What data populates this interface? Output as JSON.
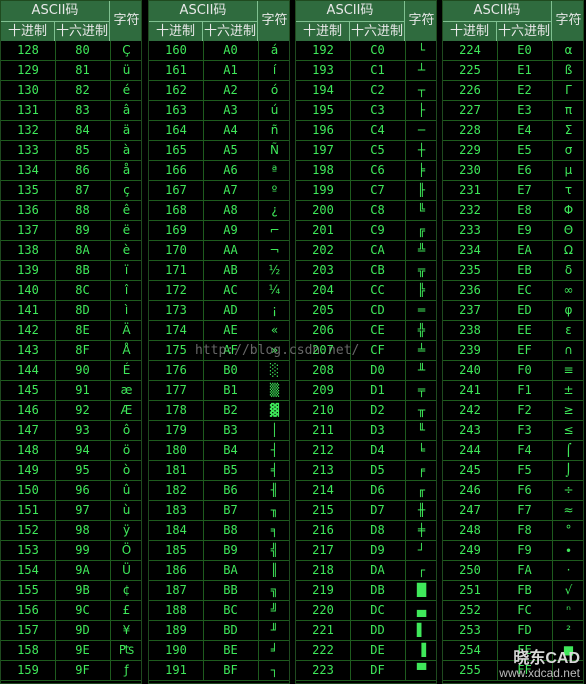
{
  "header": {
    "ascii": "ASCII码",
    "dec": "十进制",
    "hex": "十六进制",
    "char": "字符"
  },
  "watermark": "http://blog.csdn.net/",
  "logo": {
    "top": "晓东CAD",
    "bottom": "www.xdcad.net"
  },
  "colors": {
    "header_bg": "#2f6b3e",
    "text": "#3fe85a",
    "grid": "#1e5b1e"
  },
  "columns": [
    {
      "rows": [
        {
          "dec": "128",
          "hex": "80",
          "char": "Ç"
        },
        {
          "dec": "129",
          "hex": "81",
          "char": "ü"
        },
        {
          "dec": "130",
          "hex": "82",
          "char": "é"
        },
        {
          "dec": "131",
          "hex": "83",
          "char": "â"
        },
        {
          "dec": "132",
          "hex": "84",
          "char": "ä"
        },
        {
          "dec": "133",
          "hex": "85",
          "char": "à"
        },
        {
          "dec": "134",
          "hex": "86",
          "char": "å"
        },
        {
          "dec": "135",
          "hex": "87",
          "char": "ç"
        },
        {
          "dec": "136",
          "hex": "88",
          "char": "ê"
        },
        {
          "dec": "137",
          "hex": "89",
          "char": "ë"
        },
        {
          "dec": "138",
          "hex": "8A",
          "char": "è"
        },
        {
          "dec": "139",
          "hex": "8B",
          "char": "ï"
        },
        {
          "dec": "140",
          "hex": "8C",
          "char": "î"
        },
        {
          "dec": "141",
          "hex": "8D",
          "char": "ì"
        },
        {
          "dec": "142",
          "hex": "8E",
          "char": "Ä"
        },
        {
          "dec": "143",
          "hex": "8F",
          "char": "Å"
        },
        {
          "dec": "144",
          "hex": "90",
          "char": "É"
        },
        {
          "dec": "145",
          "hex": "91",
          "char": "æ"
        },
        {
          "dec": "146",
          "hex": "92",
          "char": "Æ"
        },
        {
          "dec": "147",
          "hex": "93",
          "char": "ô"
        },
        {
          "dec": "148",
          "hex": "94",
          "char": "ö"
        },
        {
          "dec": "149",
          "hex": "95",
          "char": "ò"
        },
        {
          "dec": "150",
          "hex": "96",
          "char": "û"
        },
        {
          "dec": "151",
          "hex": "97",
          "char": "ù"
        },
        {
          "dec": "152",
          "hex": "98",
          "char": "ÿ"
        },
        {
          "dec": "153",
          "hex": "99",
          "char": "Ö"
        },
        {
          "dec": "154",
          "hex": "9A",
          "char": "Ü"
        },
        {
          "dec": "155",
          "hex": "9B",
          "char": "¢"
        },
        {
          "dec": "156",
          "hex": "9C",
          "char": "£"
        },
        {
          "dec": "157",
          "hex": "9D",
          "char": "¥"
        },
        {
          "dec": "158",
          "hex": "9E",
          "char": "₧"
        },
        {
          "dec": "159",
          "hex": "9F",
          "char": "ƒ"
        }
      ]
    },
    {
      "rows": [
        {
          "dec": "160",
          "hex": "A0",
          "char": "á"
        },
        {
          "dec": "161",
          "hex": "A1",
          "char": "í"
        },
        {
          "dec": "162",
          "hex": "A2",
          "char": "ó"
        },
        {
          "dec": "163",
          "hex": "A3",
          "char": "ú"
        },
        {
          "dec": "164",
          "hex": "A4",
          "char": "ñ"
        },
        {
          "dec": "165",
          "hex": "A5",
          "char": "Ñ"
        },
        {
          "dec": "166",
          "hex": "A6",
          "char": "ª"
        },
        {
          "dec": "167",
          "hex": "A7",
          "char": "º"
        },
        {
          "dec": "168",
          "hex": "A8",
          "char": "¿"
        },
        {
          "dec": "169",
          "hex": "A9",
          "char": "⌐"
        },
        {
          "dec": "170",
          "hex": "AA",
          "char": "¬"
        },
        {
          "dec": "171",
          "hex": "AB",
          "char": "½"
        },
        {
          "dec": "172",
          "hex": "AC",
          "char": "¼"
        },
        {
          "dec": "173",
          "hex": "AD",
          "char": "¡"
        },
        {
          "dec": "174",
          "hex": "AE",
          "char": "«"
        },
        {
          "dec": "175",
          "hex": "AF",
          "char": "»"
        },
        {
          "dec": "176",
          "hex": "B0",
          "char": "░"
        },
        {
          "dec": "177",
          "hex": "B1",
          "char": "▒"
        },
        {
          "dec": "178",
          "hex": "B2",
          "char": "▓"
        },
        {
          "dec": "179",
          "hex": "B3",
          "char": "│"
        },
        {
          "dec": "180",
          "hex": "B4",
          "char": "┤"
        },
        {
          "dec": "181",
          "hex": "B5",
          "char": "╡"
        },
        {
          "dec": "182",
          "hex": "B6",
          "char": "╢"
        },
        {
          "dec": "183",
          "hex": "B7",
          "char": "╖"
        },
        {
          "dec": "184",
          "hex": "B8",
          "char": "╕"
        },
        {
          "dec": "185",
          "hex": "B9",
          "char": "╣"
        },
        {
          "dec": "186",
          "hex": "BA",
          "char": "║"
        },
        {
          "dec": "187",
          "hex": "BB",
          "char": "╗"
        },
        {
          "dec": "188",
          "hex": "BC",
          "char": "╝"
        },
        {
          "dec": "189",
          "hex": "BD",
          "char": "╜"
        },
        {
          "dec": "190",
          "hex": "BE",
          "char": "╛"
        },
        {
          "dec": "191",
          "hex": "BF",
          "char": "┐"
        }
      ]
    },
    {
      "rows": [
        {
          "dec": "192",
          "hex": "C0",
          "char": "└"
        },
        {
          "dec": "193",
          "hex": "C1",
          "char": "┴"
        },
        {
          "dec": "194",
          "hex": "C2",
          "char": "┬"
        },
        {
          "dec": "195",
          "hex": "C3",
          "char": "├"
        },
        {
          "dec": "196",
          "hex": "C4",
          "char": "─"
        },
        {
          "dec": "197",
          "hex": "C5",
          "char": "┼"
        },
        {
          "dec": "198",
          "hex": "C6",
          "char": "╞"
        },
        {
          "dec": "199",
          "hex": "C7",
          "char": "╟"
        },
        {
          "dec": "200",
          "hex": "C8",
          "char": "╚"
        },
        {
          "dec": "201",
          "hex": "C9",
          "char": "╔"
        },
        {
          "dec": "202",
          "hex": "CA",
          "char": "╩"
        },
        {
          "dec": "203",
          "hex": "CB",
          "char": "╦"
        },
        {
          "dec": "204",
          "hex": "CC",
          "char": "╠"
        },
        {
          "dec": "205",
          "hex": "CD",
          "char": "═"
        },
        {
          "dec": "206",
          "hex": "CE",
          "char": "╬"
        },
        {
          "dec": "207",
          "hex": "CF",
          "char": "╧"
        },
        {
          "dec": "208",
          "hex": "D0",
          "char": "╨"
        },
        {
          "dec": "209",
          "hex": "D1",
          "char": "╤"
        },
        {
          "dec": "210",
          "hex": "D2",
          "char": "╥"
        },
        {
          "dec": "211",
          "hex": "D3",
          "char": "╙"
        },
        {
          "dec": "212",
          "hex": "D4",
          "char": "╘"
        },
        {
          "dec": "213",
          "hex": "D5",
          "char": "╒"
        },
        {
          "dec": "214",
          "hex": "D6",
          "char": "╓"
        },
        {
          "dec": "215",
          "hex": "D7",
          "char": "╫"
        },
        {
          "dec": "216",
          "hex": "D8",
          "char": "╪"
        },
        {
          "dec": "217",
          "hex": "D9",
          "char": "┘"
        },
        {
          "dec": "218",
          "hex": "DA",
          "char": "┌"
        },
        {
          "dec": "219",
          "hex": "DB",
          "char": "█"
        },
        {
          "dec": "220",
          "hex": "DC",
          "char": "▄"
        },
        {
          "dec": "221",
          "hex": "DD",
          "char": "▌"
        },
        {
          "dec": "222",
          "hex": "DE",
          "char": "▐"
        },
        {
          "dec": "223",
          "hex": "DF",
          "char": "▀"
        }
      ]
    },
    {
      "rows": [
        {
          "dec": "224",
          "hex": "E0",
          "char": "α"
        },
        {
          "dec": "225",
          "hex": "E1",
          "char": "ß"
        },
        {
          "dec": "226",
          "hex": "E2",
          "char": "Γ"
        },
        {
          "dec": "227",
          "hex": "E3",
          "char": "π"
        },
        {
          "dec": "228",
          "hex": "E4",
          "char": "Σ"
        },
        {
          "dec": "229",
          "hex": "E5",
          "char": "σ"
        },
        {
          "dec": "230",
          "hex": "E6",
          "char": "µ"
        },
        {
          "dec": "231",
          "hex": "E7",
          "char": "τ"
        },
        {
          "dec": "232",
          "hex": "E8",
          "char": "Φ"
        },
        {
          "dec": "233",
          "hex": "E9",
          "char": "Θ"
        },
        {
          "dec": "234",
          "hex": "EA",
          "char": "Ω"
        },
        {
          "dec": "235",
          "hex": "EB",
          "char": "δ"
        },
        {
          "dec": "236",
          "hex": "EC",
          "char": "∞"
        },
        {
          "dec": "237",
          "hex": "ED",
          "char": "φ"
        },
        {
          "dec": "238",
          "hex": "EE",
          "char": "ε"
        },
        {
          "dec": "239",
          "hex": "EF",
          "char": "∩"
        },
        {
          "dec": "240",
          "hex": "F0",
          "char": "≡"
        },
        {
          "dec": "241",
          "hex": "F1",
          "char": "±"
        },
        {
          "dec": "242",
          "hex": "F2",
          "char": "≥"
        },
        {
          "dec": "243",
          "hex": "F3",
          "char": "≤"
        },
        {
          "dec": "244",
          "hex": "F4",
          "char": "⌠"
        },
        {
          "dec": "245",
          "hex": "F5",
          "char": "⌡"
        },
        {
          "dec": "246",
          "hex": "F6",
          "char": "÷"
        },
        {
          "dec": "247",
          "hex": "F7",
          "char": "≈"
        },
        {
          "dec": "248",
          "hex": "F8",
          "char": "°"
        },
        {
          "dec": "249",
          "hex": "F9",
          "char": "∙"
        },
        {
          "dec": "250",
          "hex": "FA",
          "char": "·"
        },
        {
          "dec": "251",
          "hex": "FB",
          "char": "√"
        },
        {
          "dec": "252",
          "hex": "FC",
          "char": "ⁿ"
        },
        {
          "dec": "253",
          "hex": "FD",
          "char": "²"
        },
        {
          "dec": "254",
          "hex": "FE",
          "char": "■"
        },
        {
          "dec": "255",
          "hex": "FF",
          "char": ""
        }
      ]
    }
  ]
}
